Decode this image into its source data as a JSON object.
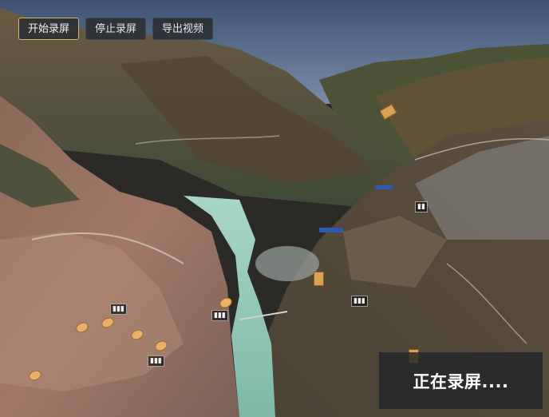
{
  "toolbar": {
    "start_label": "开始录屏",
    "stop_label": "停止录屏",
    "export_label": "导出视频"
  },
  "status": {
    "recording_text": "正在录屏...."
  },
  "colors": {
    "accent_border": "#d7b46a",
    "sky_top": "#3d5273",
    "sky_bottom": "#7a8ca8",
    "river": "#8ec7b4"
  },
  "icons": [
    "location-pin-icon",
    "marker-tag-icon"
  ]
}
